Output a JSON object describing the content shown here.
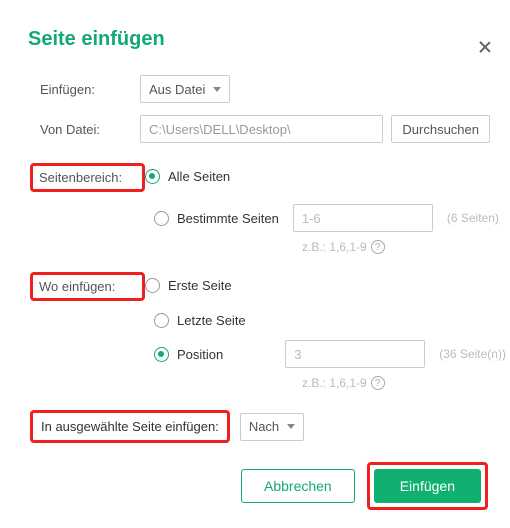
{
  "title": "Seite einfügen",
  "labels": {
    "insert": "Einfügen:",
    "from_file": "Von Datei:",
    "page_range": "Seitenbereich:",
    "where": "Wo einfügen:",
    "into_selected": "In ausgewählte Seite einfügen:"
  },
  "insert_mode": {
    "selected": "Aus Datei"
  },
  "file": {
    "path": "C:\\Users\\DELL\\Desktop\\",
    "browse": "Durchsuchen"
  },
  "page_range": {
    "all": "Alle Seiten",
    "specific": "Bestimmte Seiten",
    "specific_value": "1-6",
    "count": "(6 Seiten)",
    "hint": "z.B.: 1,6,1-9"
  },
  "where": {
    "first": "Erste Seite",
    "last": "Letzte Seite",
    "position": "Position",
    "position_value": "3",
    "count": "(36 Seite(n))",
    "hint": "z.B.: 1,6,1-9"
  },
  "direction": {
    "selected": "Nach"
  },
  "buttons": {
    "cancel": "Abbrechen",
    "ok": "Einfügen"
  },
  "icons": {
    "help": "?"
  }
}
